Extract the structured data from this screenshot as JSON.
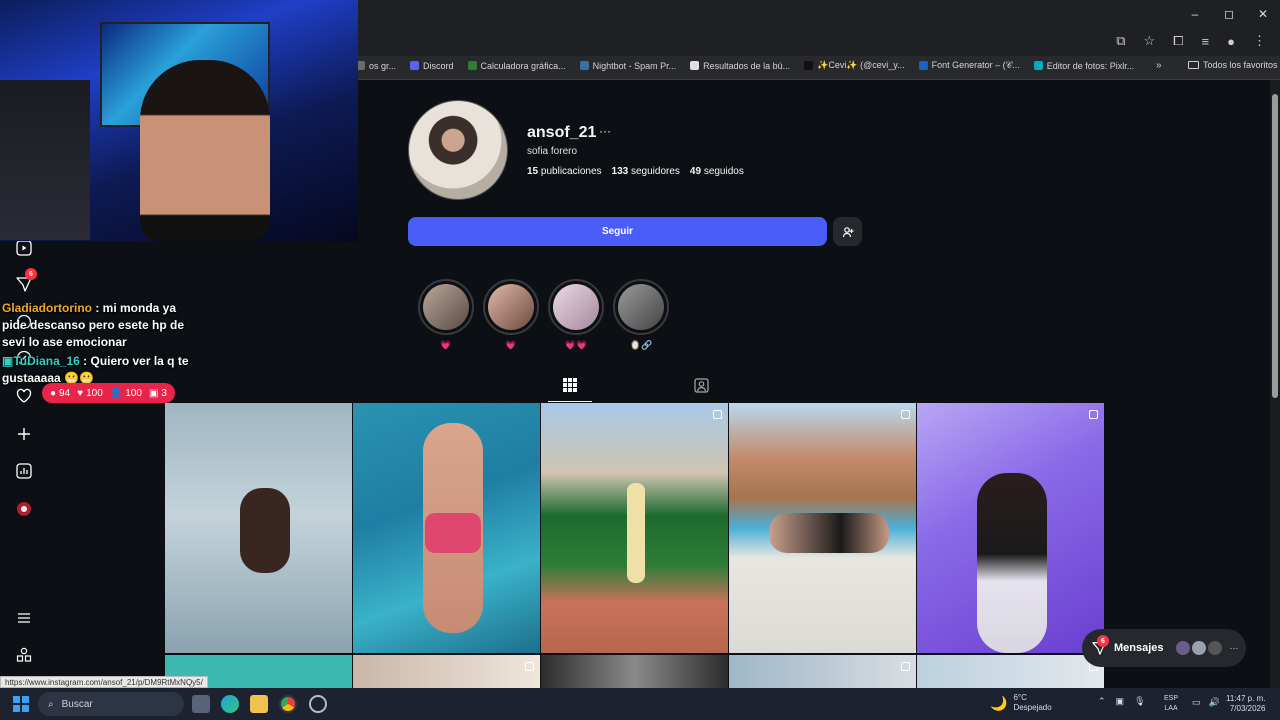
{
  "browser": {
    "window_controls": [
      "–",
      "◻",
      "✕"
    ],
    "bookmarks": [
      {
        "label": "os gr...",
        "color": "#6b6b6b"
      },
      {
        "label": "Discord",
        "color": "#5865f2"
      },
      {
        "label": "Calculadora gráfica...",
        "color": "#2e7d32"
      },
      {
        "label": "Nightbot - Spam Pr...",
        "color": "#3b6ea5"
      },
      {
        "label": "Resultados de la bú...",
        "color": "#e0e0e0"
      },
      {
        "label": "✨Cevi✨ (@cevi_y...",
        "color": "#111111"
      },
      {
        "label": "Font Generator – (𝒞...",
        "color": "#1565c0"
      },
      {
        "label": "Editor de fotos: Pixlr...",
        "color": "#00acc1"
      }
    ],
    "more_bookmarks": "»",
    "all_favorites": "Todos los favoritos",
    "status_url": "https://www.instagram.com/ansof_21/p/DM9RtMxNQy5/"
  },
  "profile": {
    "username": "ansof_21",
    "more": "···",
    "full_name": "sofia forero",
    "posts_count": "15",
    "posts_label": "publicaciones",
    "followers_count": "133",
    "followers_label": "seguidores",
    "following_count": "49",
    "following_label": "seguidos",
    "follow_label": "Seguir",
    "suggest_icon": "add-person-icon"
  },
  "highlights": [
    {
      "label": "💗",
      "color": "#8c7a6e"
    },
    {
      "label": "💗",
      "color": "#c9978a"
    },
    {
      "label": "💗💗",
      "color": "#d8c6cf"
    },
    {
      "label": "🪞🔗",
      "color": "#8a8a8a"
    }
  ],
  "tabs": {
    "grid_icon": "grid-icon",
    "tagged_icon": "tagged-icon"
  },
  "chat": [
    {
      "user": "Gladiadortorino",
      "user_color": "#f5a623",
      "text": ": mi monda ya pide descanso pero esete hp de sevi lo ase emocionar"
    },
    {
      "user": "TuDiana_16",
      "user_color": "#32d1c5",
      "text": ": Quiero ver la q te gustaaaaa 😬😬"
    }
  ],
  "stream_stats": {
    "comments": "94",
    "likes": "100",
    "viewers": "100",
    "followers": "3"
  },
  "sidebar": {
    "notifications_badge": "6"
  },
  "messages": {
    "label": "Mensajes",
    "badge": "6",
    "more": "···"
  },
  "taskbar": {
    "search_placeholder": "Buscar",
    "weather_temp": "6°C",
    "weather_desc": "Despejado",
    "lang_1": "ESP",
    "lang_2": "LAA",
    "time": "11:47 p. m.",
    "date": "7/03/2026"
  }
}
